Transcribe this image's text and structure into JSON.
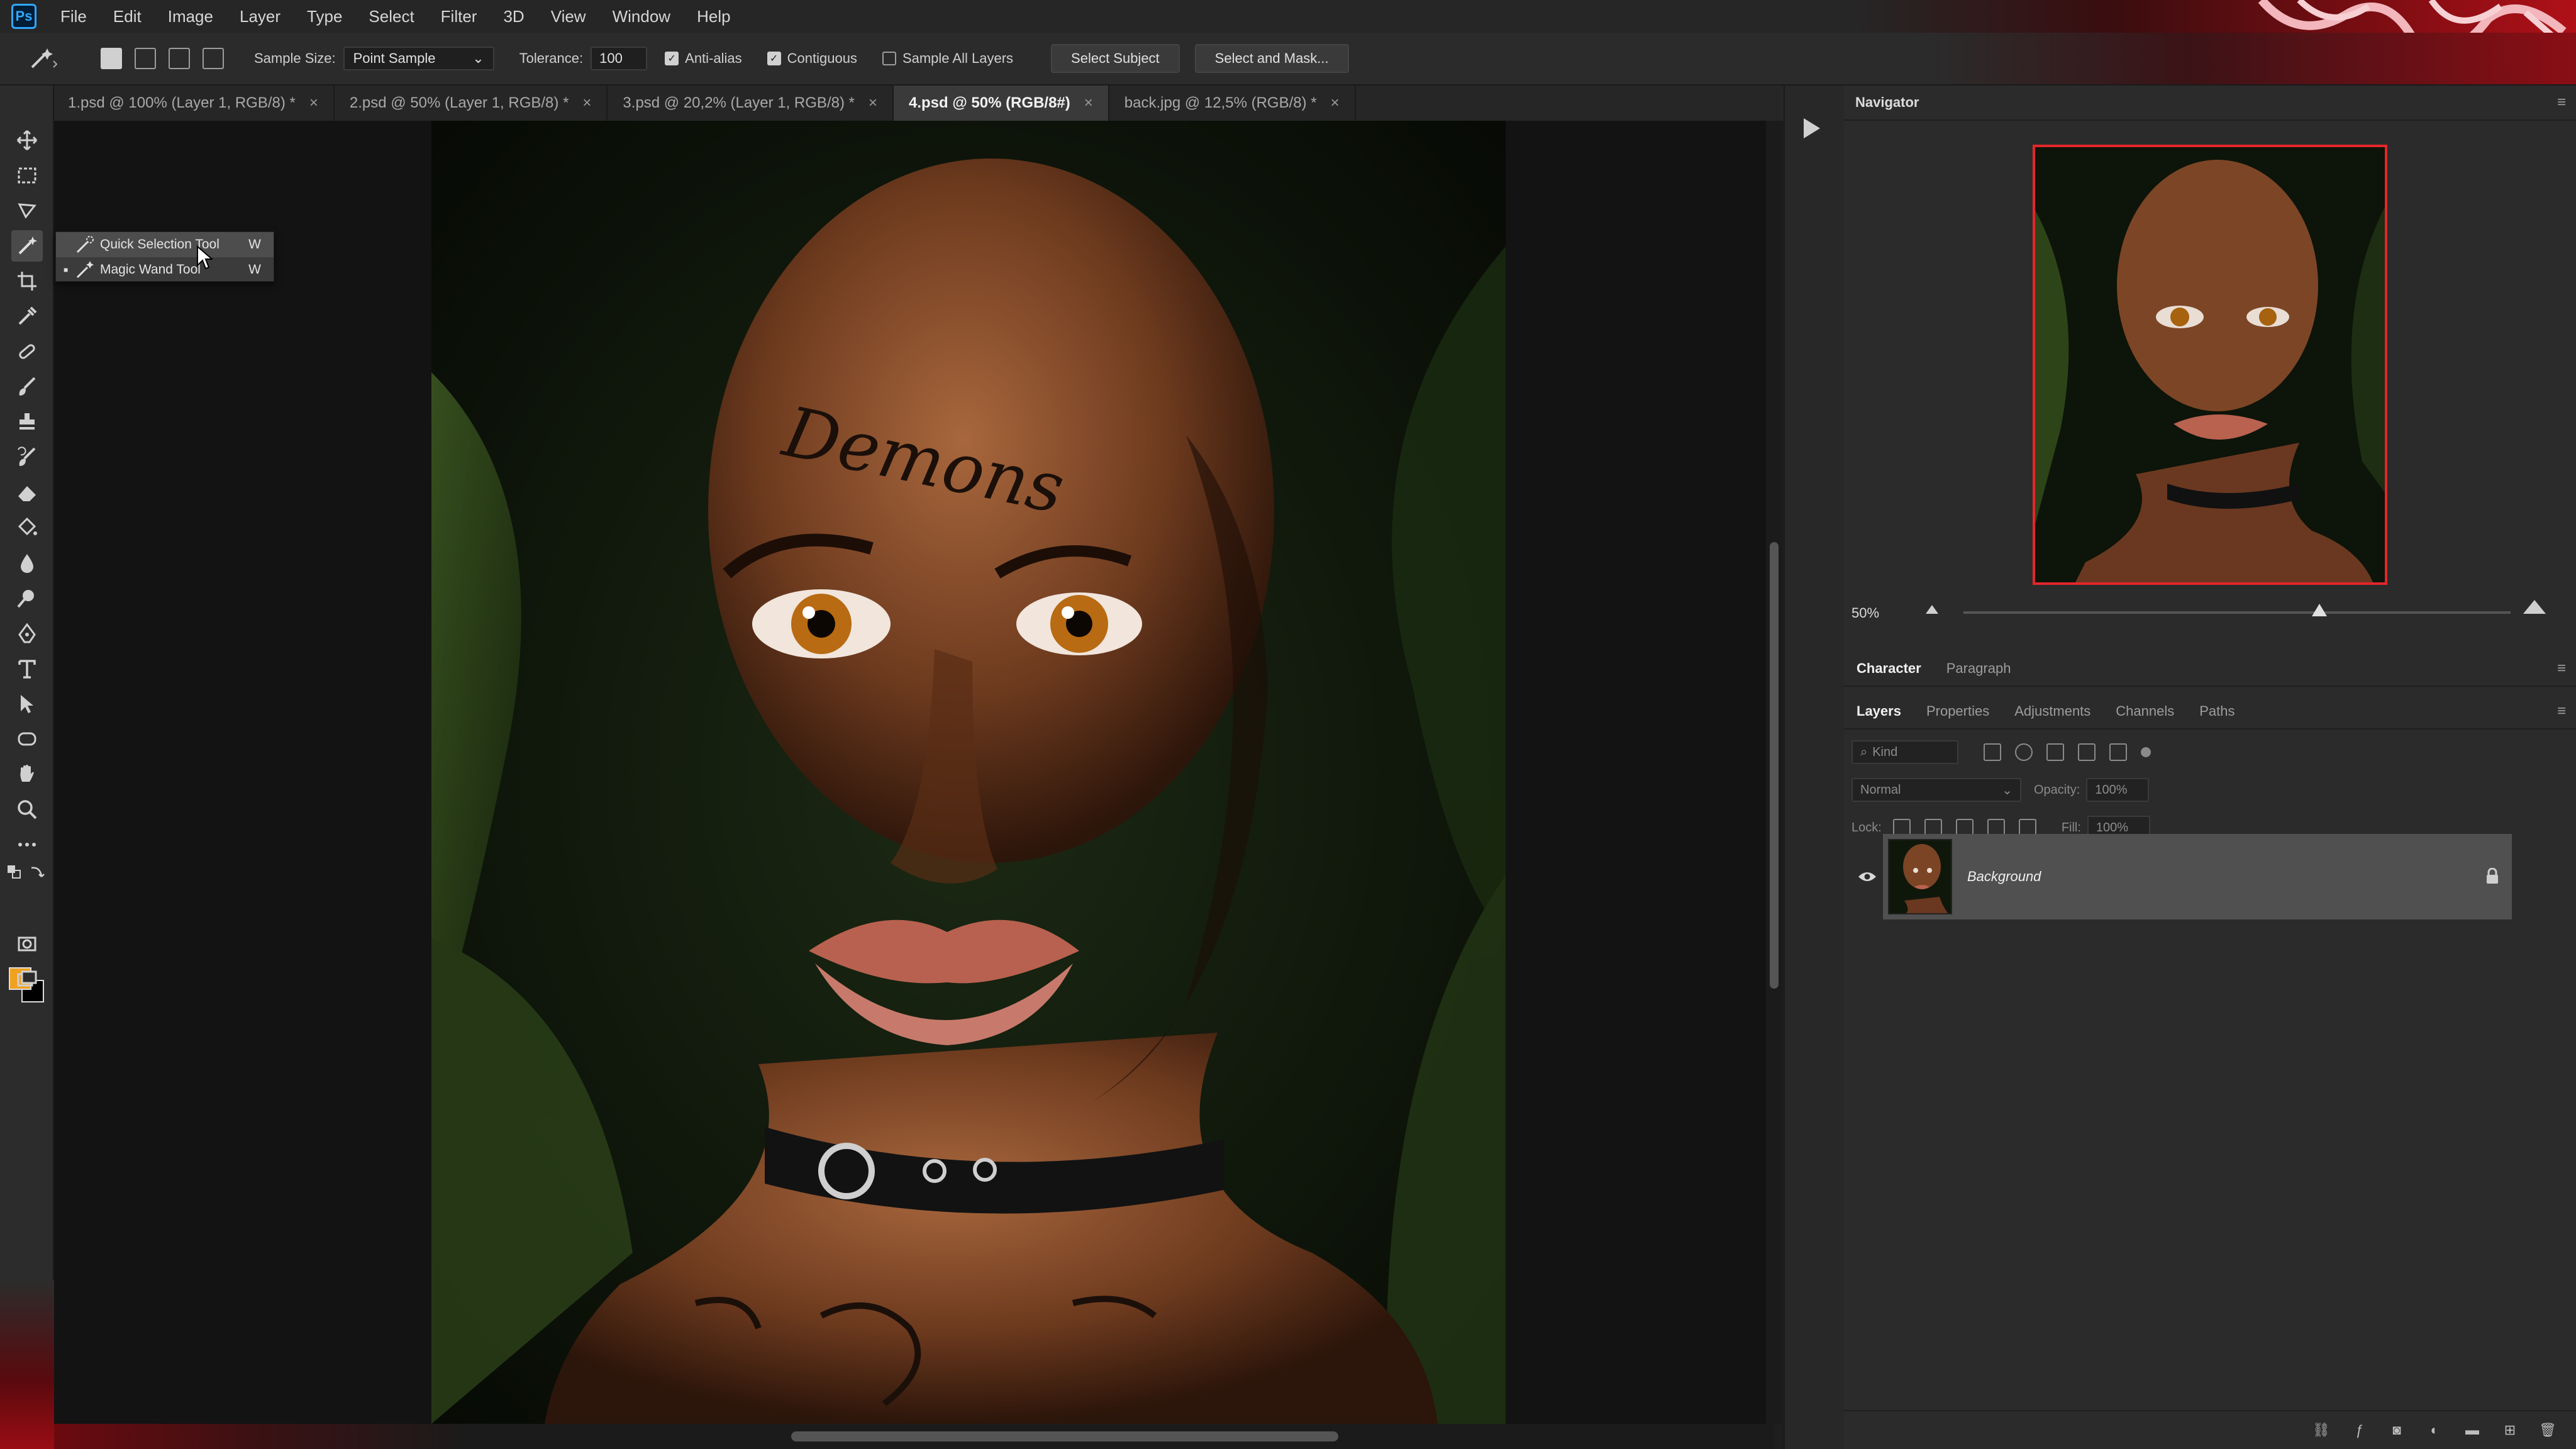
{
  "menubar": {
    "logo": "Ps",
    "items": [
      "File",
      "Edit",
      "Image",
      "Layer",
      "Type",
      "Select",
      "Filter",
      "3D",
      "View",
      "Window",
      "Help"
    ]
  },
  "options": {
    "sample_size_label": "Sample Size:",
    "sample_size_value": "Point Sample",
    "tolerance_label": "Tolerance:",
    "tolerance_value": "100",
    "anti_alias_label": "Anti-alias",
    "anti_alias_checked": true,
    "contiguous_label": "Contiguous",
    "contiguous_checked": true,
    "sample_all_label": "Sample All Layers",
    "sample_all_checked": false,
    "select_subject": "Select Subject",
    "select_and_mask": "Select and Mask..."
  },
  "tabs": [
    {
      "label": "1.psd @ 100% (Layer 1, RGB/8) *",
      "active": false
    },
    {
      "label": "2.psd @ 50% (Layer 1, RGB/8) *",
      "active": false
    },
    {
      "label": "3.psd @ 20,2% (Layer 1, RGB/8) *",
      "active": false
    },
    {
      "label": "4.psd @ 50% (RGB/8#)",
      "active": true
    },
    {
      "label": "back.jpg @ 12,5% (RGB/8) *",
      "active": false
    }
  ],
  "tab_close": "×",
  "flyout": {
    "items": [
      {
        "label": "Quick Selection Tool",
        "key": "W",
        "icon": "quick-selection-icon"
      },
      {
        "label": "Magic Wand Tool",
        "key": "W",
        "icon": "magic-wand-icon"
      }
    ],
    "bullet": "■"
  },
  "colors": {
    "foreground": "#f0a11d",
    "background": "#000000",
    "navigator_frame": "#e3262b",
    "accent_red": "#b01018"
  },
  "navigator": {
    "title": "Navigator",
    "zoom": "50%",
    "zoom_fraction": 0.65
  },
  "char_tabs": [
    {
      "label": "Character",
      "active": true
    },
    {
      "label": "Paragraph",
      "active": false
    }
  ],
  "layer_tabs": [
    {
      "label": "Layers",
      "active": true
    },
    {
      "label": "Properties",
      "active": false
    },
    {
      "label": "Adjustments",
      "active": false
    },
    {
      "label": "Channels",
      "active": false
    },
    {
      "label": "Paths",
      "active": false
    }
  ],
  "layers_panel": {
    "kind_placeholder": "Kind",
    "blend_mode": "Normal",
    "opacity_label": "Opacity:",
    "opacity_value": "100%",
    "lock_label": "Lock:",
    "fill_label": "Fill:",
    "fill_value": "100%",
    "layers": [
      {
        "name": "Background",
        "visible": true,
        "locked": true
      }
    ]
  },
  "artwork": {
    "text_forehead": "Demons"
  }
}
